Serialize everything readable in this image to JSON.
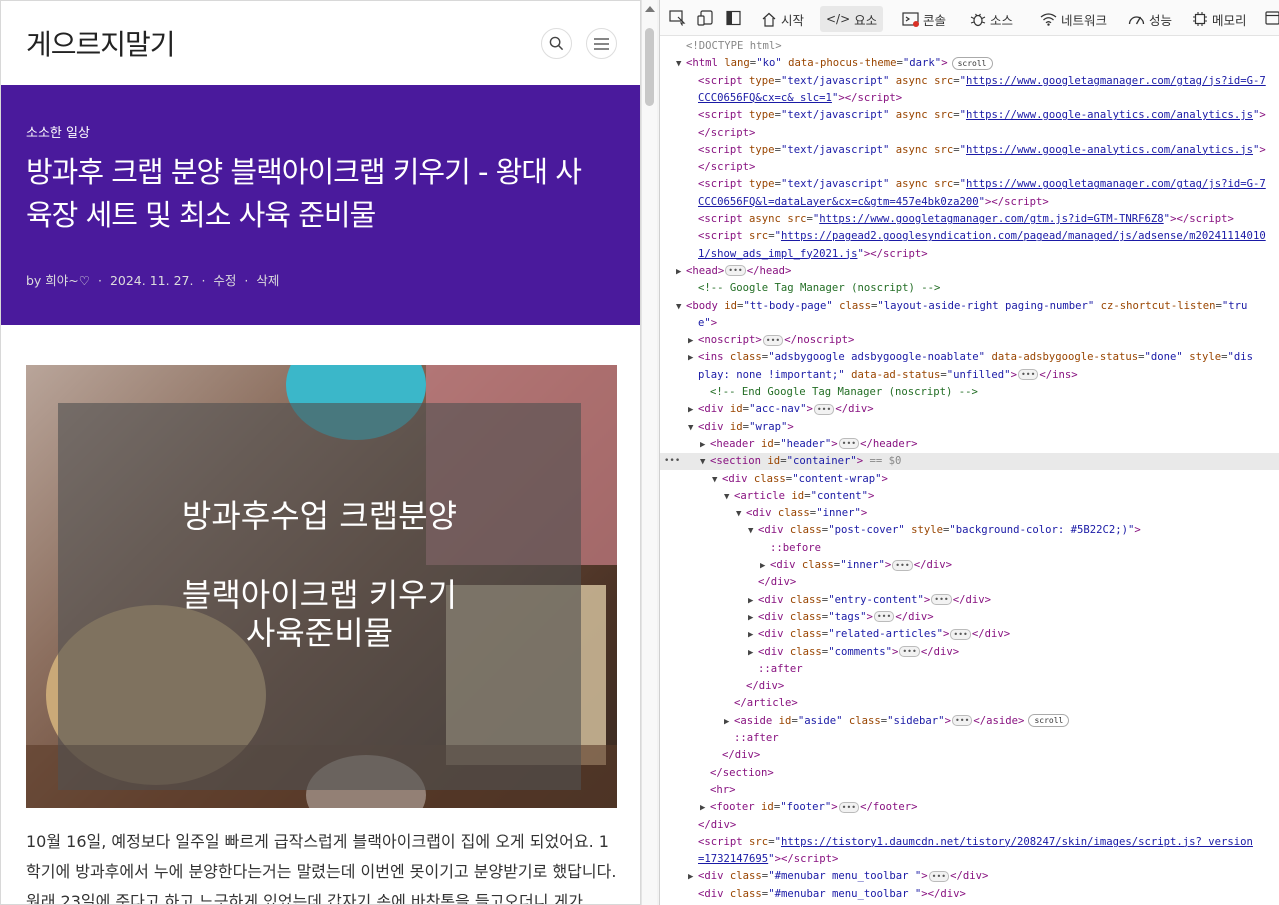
{
  "blog": {
    "title": "게으르지말기",
    "category": "소소한 일상",
    "post_title": "방과후 크랩 분양 블랙아이크랩 키우기 - 왕대 사육장 세트 및 최소 사육 준비물",
    "meta": {
      "author": "by 희야~♡",
      "date": "2024. 11. 27.",
      "edit": "수정",
      "delete": "삭제",
      "sep": "·"
    },
    "image_text": {
      "line1": "방과후수업 크랩분양",
      "line2": "블랙아이크랩 키우기",
      "line3": "사육준비물"
    },
    "body": "10월 16일, 예정보다 일주일 빠르게 급작스럽게 블랙아이크랩이 집에 오게 되었어요. 1학기에 방과후에서 누에 분양한다는거는 말렸는데 이번엔 못이기고 분양받기로 했답니다. 원래 23일에 준다고 하고 느긋하게 있었는데 갑자기 손에 바찬통을 들고오더니 게가"
  },
  "devtools": {
    "tabs": [
      "시작",
      "요소",
      "콘솔",
      "소스",
      "네트워크",
      "성능",
      "메모리"
    ],
    "active_tab": "요소",
    "lines": [
      {
        "indent": 0,
        "tri": "",
        "html": "<span class=\"dim\">&lt;!DOCTYPE html&gt;</span>"
      },
      {
        "indent": 0,
        "tri": "▼",
        "html": "<span class=\"tg\">&lt;html</span> <span class=\"at\">lang</span>=<span class=\"av\">\"ko\"</span> <span class=\"at\">data-phocus-theme</span>=<span class=\"av\">\"dark\"</span><span class=\"tg\">&gt;</span><span class=\"badge\">scroll</span>"
      },
      {
        "indent": 1,
        "tri": "",
        "html": "<span class=\"tg\">&lt;script</span> <span class=\"at\">type</span>=<span class=\"av\">\"text/javascript\"</span> <span class=\"at\">async</span> <span class=\"at\">src</span>=<span class=\"av\">\"</span><span class=\"lk\">https://www.googletagmanager.com/gtag/js?id=G-7</span>"
      },
      {
        "indent": 1,
        "tri": "",
        "html": "<span class=\"lk\">CCC0656FQ&amp;cx=c&amp; slc=1</span><span class=\"av\">\"</span><span class=\"tg\">&gt;&lt;/script&gt;</span>"
      },
      {
        "indent": 1,
        "tri": "",
        "html": "<span class=\"tg\">&lt;script</span> <span class=\"at\">type</span>=<span class=\"av\">\"text/javascript\"</span> <span class=\"at\">async</span> <span class=\"at\">src</span>=<span class=\"av\">\"</span><span class=\"lk\">https://www.google-analytics.com/analytics.js</span><span class=\"av\">\"</span><span class=\"tg\">&gt;</span>"
      },
      {
        "indent": 1,
        "tri": "",
        "html": "<span class=\"tg\">&lt;/script&gt;</span>"
      },
      {
        "indent": 1,
        "tri": "",
        "html": "<span class=\"tg\">&lt;script</span> <span class=\"at\">type</span>=<span class=\"av\">\"text/javascript\"</span> <span class=\"at\">async</span> <span class=\"at\">src</span>=<span class=\"av\">\"</span><span class=\"lk\">https://www.google-analytics.com/analytics.js</span><span class=\"av\">\"</span><span class=\"tg\">&gt;</span>"
      },
      {
        "indent": 1,
        "tri": "",
        "html": "<span class=\"tg\">&lt;/script&gt;</span>"
      },
      {
        "indent": 1,
        "tri": "",
        "html": "<span class=\"tg\">&lt;script</span> <span class=\"at\">type</span>=<span class=\"av\">\"text/javascript\"</span> <span class=\"at\">async</span> <span class=\"at\">src</span>=<span class=\"av\">\"</span><span class=\"lk\">https://www.googletagmanager.com/gtag/js?id=G-7</span>"
      },
      {
        "indent": 1,
        "tri": "",
        "html": "<span class=\"lk\">CCC0656FQ&amp;l=dataLayer&amp;cx=c&amp;gtm=457e4bk0za200</span><span class=\"av\">\"</span><span class=\"tg\">&gt;&lt;/script&gt;</span>"
      },
      {
        "indent": 1,
        "tri": "",
        "html": "<span class=\"tg\">&lt;script</span> <span class=\"at\">async</span> <span class=\"at\">src</span>=<span class=\"av\">\"</span><span class=\"lk\">https://www.googletagmanager.com/gtm.js?id=GTM-TNRF6Z8</span><span class=\"av\">\"</span><span class=\"tg\">&gt;&lt;/script&gt;</span>"
      },
      {
        "indent": 1,
        "tri": "",
        "html": "<span class=\"tg\">&lt;script</span> <span class=\"at\">src</span>=<span class=\"av\">\"</span><span class=\"lk\">https://pagead2.googlesyndication.com/pagead/managed/js/adsense/m20241114010</span>"
      },
      {
        "indent": 1,
        "tri": "",
        "html": "<span class=\"lk\">1/show_ads_impl_fy2021.js</span><span class=\"av\">\"</span><span class=\"tg\">&gt;&lt;/script&gt;</span>"
      },
      {
        "indent": 0,
        "tri": "▶",
        "html": "<span class=\"tg\">&lt;head&gt;</span><span class=\"ell\">•••</span><span class=\"tg\">&lt;/head&gt;</span>"
      },
      {
        "indent": 1,
        "tri": "",
        "html": "<span class=\"cm\">&lt;!-- Google Tag Manager (noscript) --&gt;</span>"
      },
      {
        "indent": 0,
        "tri": "▼",
        "html": "<span class=\"tg\">&lt;body</span> <span class=\"at\">id</span>=<span class=\"av\">\"tt-body-page\"</span> <span class=\"at\">class</span>=<span class=\"av\">\"layout-aside-right paging-number\"</span> <span class=\"at\">cz-shortcut-listen</span>=<span class=\"av\">\"tru</span>"
      },
      {
        "indent": 1,
        "tri": "",
        "html": "<span class=\"av\">e\"</span><span class=\"tg\">&gt;</span>"
      },
      {
        "indent": 1,
        "tri": "▶",
        "html": "<span class=\"tg\">&lt;noscript&gt;</span><span class=\"ell\">•••</span><span class=\"tg\">&lt;/noscript&gt;</span>"
      },
      {
        "indent": 1,
        "tri": "▶",
        "html": "<span class=\"tg\">&lt;ins</span> <span class=\"at\">class</span>=<span class=\"av\">\"adsbygoogle adsbygoogle-noablate\"</span> <span class=\"at\">data-adsbygoogle-status</span>=<span class=\"av\">\"done\"</span> <span class=\"at\">style</span>=<span class=\"av\">\"dis</span>"
      },
      {
        "indent": 1,
        "tri": "",
        "html": "<span class=\"av\">play: none !important;\"</span> <span class=\"at\">data-ad-status</span>=<span class=\"av\">\"unfilled\"</span><span class=\"tg\">&gt;</span><span class=\"ell\">•••</span><span class=\"tg\">&lt;/ins&gt;</span>"
      },
      {
        "indent": 2,
        "tri": "",
        "html": "<span class=\"cm\">&lt;!-- End Google Tag Manager (noscript) --&gt;</span>"
      },
      {
        "indent": 1,
        "tri": "▶",
        "html": "<span class=\"tg\">&lt;div</span> <span class=\"at\">id</span>=<span class=\"av\">\"acc-nav\"</span><span class=\"tg\">&gt;</span><span class=\"ell\">•••</span><span class=\"tg\">&lt;/div&gt;</span>"
      },
      {
        "indent": 1,
        "tri": "▼",
        "html": "<span class=\"tg\">&lt;div</span> <span class=\"at\">id</span>=<span class=\"av\">\"wrap\"</span><span class=\"tg\">&gt;</span>"
      },
      {
        "indent": 2,
        "tri": "▶",
        "html": "<span class=\"tg\">&lt;header</span> <span class=\"at\">id</span>=<span class=\"av\">\"header\"</span><span class=\"tg\">&gt;</span><span class=\"ell\">•••</span><span class=\"tg\">&lt;/header&gt;</span>"
      },
      {
        "indent": 2,
        "tri": "▼",
        "sel": true,
        "html": "<span class=\"tg\">&lt;section</span> <span class=\"at\">id</span>=<span class=\"av\">\"container\"</span><span class=\"tg\">&gt;</span> <span class=\"dim\">== $0</span>"
      },
      {
        "indent": 3,
        "tri": "▼",
        "html": "<span class=\"tg\">&lt;div</span> <span class=\"at\">class</span>=<span class=\"av\">\"content-wrap\"</span><span class=\"tg\">&gt;</span>"
      },
      {
        "indent": 4,
        "tri": "▼",
        "html": "<span class=\"tg\">&lt;article</span> <span class=\"at\">id</span>=<span class=\"av\">\"content\"</span><span class=\"tg\">&gt;</span>"
      },
      {
        "indent": 5,
        "tri": "▼",
        "html": "<span class=\"tg\">&lt;div</span> <span class=\"at\">class</span>=<span class=\"av\">\"inner\"</span><span class=\"tg\">&gt;</span>"
      },
      {
        "indent": 6,
        "tri": "▼",
        "html": "<span class=\"tg\">&lt;div</span> <span class=\"at\">class</span>=<span class=\"av\">\"post-cover\"</span> <span class=\"at\">style</span>=<span class=\"av\">\"background-color: #5B22C2;)\"</span><span class=\"tg\">&gt;</span>"
      },
      {
        "indent": 7,
        "tri": "",
        "html": "<span class=\"tg\">::before</span>"
      },
      {
        "indent": 7,
        "tri": "▶",
        "html": "<span class=\"tg\">&lt;div</span> <span class=\"at\">class</span>=<span class=\"av\">\"inner\"</span><span class=\"tg\">&gt;</span><span class=\"ell\">•••</span><span class=\"tg\">&lt;/div&gt;</span>"
      },
      {
        "indent": 6,
        "tri": "",
        "html": "<span class=\"tg\">&lt;/div&gt;</span>"
      },
      {
        "indent": 6,
        "tri": "▶",
        "html": "<span class=\"tg\">&lt;div</span> <span class=\"at\">class</span>=<span class=\"av\">\"entry-content\"</span><span class=\"tg\">&gt;</span><span class=\"ell\">•••</span><span class=\"tg\">&lt;/div&gt;</span>"
      },
      {
        "indent": 6,
        "tri": "▶",
        "html": "<span class=\"tg\">&lt;div</span> <span class=\"at\">class</span>=<span class=\"av\">\"tags\"</span><span class=\"tg\">&gt;</span><span class=\"ell\">•••</span><span class=\"tg\">&lt;/div&gt;</span>"
      },
      {
        "indent": 6,
        "tri": "▶",
        "html": "<span class=\"tg\">&lt;div</span> <span class=\"at\">class</span>=<span class=\"av\">\"related-articles\"</span><span class=\"tg\">&gt;</span><span class=\"ell\">•••</span><span class=\"tg\">&lt;/div&gt;</span>"
      },
      {
        "indent": 6,
        "tri": "▶",
        "html": "<span class=\"tg\">&lt;div</span> <span class=\"at\">class</span>=<span class=\"av\">\"comments\"</span><span class=\"tg\">&gt;</span><span class=\"ell\">•••</span><span class=\"tg\">&lt;/div&gt;</span>"
      },
      {
        "indent": 6,
        "tri": "",
        "html": "<span class=\"tg\">::after</span>"
      },
      {
        "indent": 5,
        "tri": "",
        "html": "<span class=\"tg\">&lt;/div&gt;</span>"
      },
      {
        "indent": 4,
        "tri": "",
        "html": "<span class=\"tg\">&lt;/article&gt;</span>"
      },
      {
        "indent": 4,
        "tri": "▶",
        "html": "<span class=\"tg\">&lt;aside</span> <span class=\"at\">id</span>=<span class=\"av\">\"aside\"</span> <span class=\"at\">class</span>=<span class=\"av\">\"sidebar\"</span><span class=\"tg\">&gt;</span><span class=\"ell\">•••</span><span class=\"tg\">&lt;/aside&gt;</span><span class=\"badge\">scroll</span>"
      },
      {
        "indent": 4,
        "tri": "",
        "html": "<span class=\"tg\">::after</span>"
      },
      {
        "indent": 3,
        "tri": "",
        "html": "<span class=\"tg\">&lt;/div&gt;</span>"
      },
      {
        "indent": 2,
        "tri": "",
        "html": "<span class=\"tg\">&lt;/section&gt;</span>"
      },
      {
        "indent": 2,
        "tri": "",
        "html": "<span class=\"tg\">&lt;hr&gt;</span>"
      },
      {
        "indent": 2,
        "tri": "▶",
        "html": "<span class=\"tg\">&lt;footer</span> <span class=\"at\">id</span>=<span class=\"av\">\"footer\"</span><span class=\"tg\">&gt;</span><span class=\"ell\">•••</span><span class=\"tg\">&lt;/footer&gt;</span>"
      },
      {
        "indent": 1,
        "tri": "",
        "html": "<span class=\"tg\">&lt;/div&gt;</span>"
      },
      {
        "indent": 1,
        "tri": "",
        "html": "<span class=\"tg\">&lt;script</span> <span class=\"at\">src</span>=<span class=\"av\">\"</span><span class=\"lk\">https://tistory1.daumcdn.net/tistory/208247/skin/images/script.js? version</span>"
      },
      {
        "indent": 1,
        "tri": "",
        "html": "<span class=\"lk\">=1732147695</span><span class=\"av\">\"</span><span class=\"tg\">&gt;&lt;/script&gt;</span>"
      },
      {
        "indent": 1,
        "tri": "▶",
        "html": "<span class=\"tg\">&lt;div</span> <span class=\"at\">class</span>=<span class=\"av\">\"#menubar menu_toolbar \"</span><span class=\"tg\">&gt;</span><span class=\"ell\">•••</span><span class=\"tg\">&lt;/div&gt;</span>"
      },
      {
        "indent": 1,
        "tri": "",
        "html": "<span class=\"tg\">&lt;div</span> <span class=\"at\">class</span>=<span class=\"av\">\"#menubar menu_toolbar \"</span><span class=\"tg\">&gt;&lt;/div&gt;</span>"
      }
    ]
  },
  "colors": {
    "cover_bg": "#4a1a9c",
    "accent": "#1a1aa6"
  }
}
